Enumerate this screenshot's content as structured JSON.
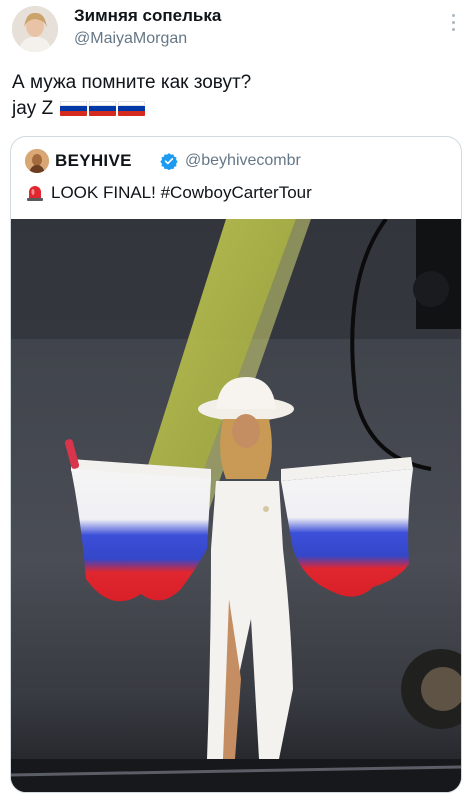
{
  "tweet": {
    "author_name": "Зимняя сопелька",
    "author_handle": "@MaiyaMorgan",
    "text_line1": "А мужа помните как зовут?",
    "text_line2": "jay Z",
    "flag_count": 3
  },
  "quoted": {
    "author_name": "BEYHIVE",
    "author_handle": "@beyhivecombr",
    "text": "LOOK FINAL! #CowboyCarterTour",
    "verified": true
  },
  "icons": {
    "more": "more-vertical-icon",
    "verified": "verified-badge-icon",
    "siren": "siren-icon",
    "flag": "russian-flag-icon"
  },
  "colors": {
    "verified": "#1d9bf0",
    "handle": "#657786",
    "border": "#cfd9de",
    "flag_white": "#ffffff",
    "flag_blue": "#0039a6",
    "flag_red": "#d52b1e"
  }
}
